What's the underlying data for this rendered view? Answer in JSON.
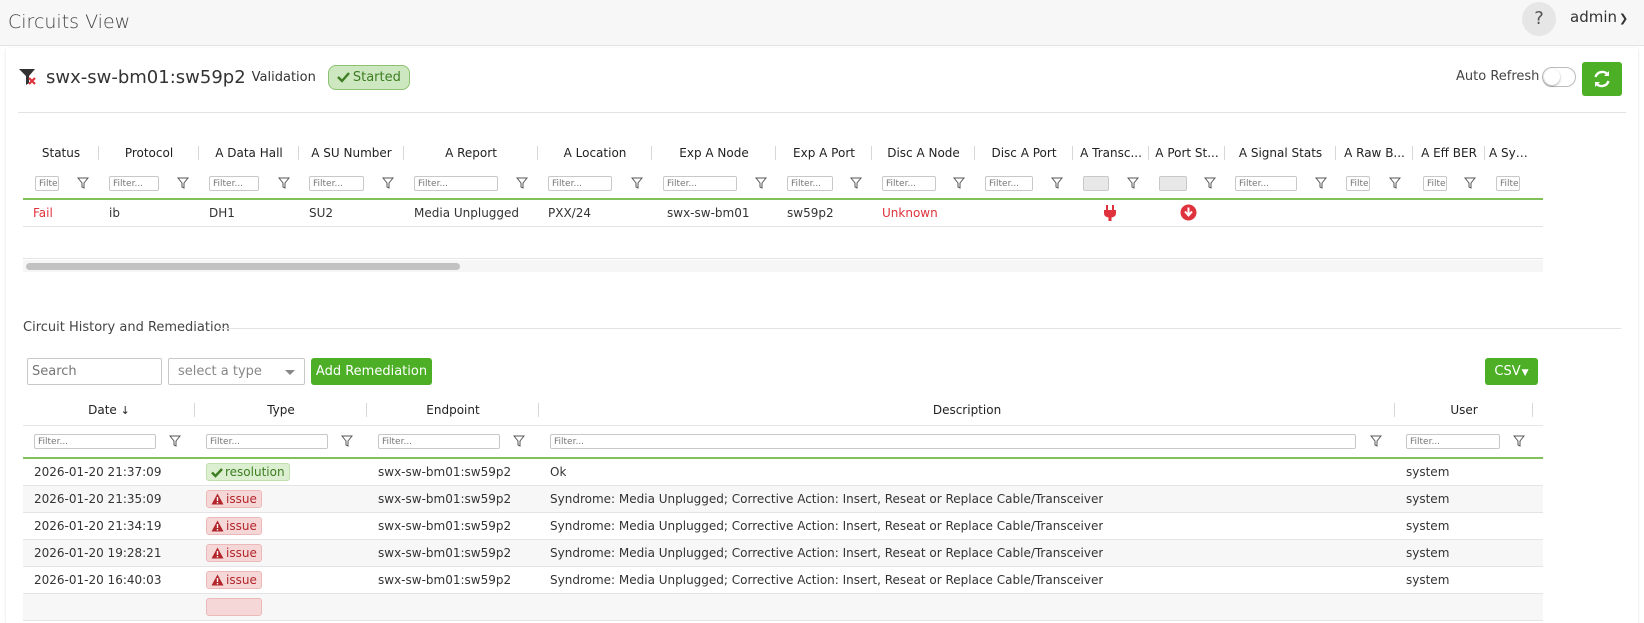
{
  "app": {
    "title": "Circuits View",
    "help": "?",
    "user": "admin"
  },
  "circuit": {
    "name": "swx-sw-bm01:sw59p2",
    "subtitle": "Validation",
    "status_badge": "Started",
    "auto_refresh_label": "Auto Refresh"
  },
  "circuit_grid": {
    "columns": [
      "Status",
      "Protocol",
      "A Data Hall",
      "A SU Number",
      "A Report",
      "A Location",
      "Exp A Node",
      "Exp A Port",
      "Disc A Node",
      "Disc A Port",
      "A Transc...",
      "A Port St...",
      "A Signal Stats",
      "A Raw B...",
      "A Eff BER",
      "A Symb..."
    ],
    "filter_placeholder": "Filter...",
    "row": {
      "status": "Fail",
      "protocol": "ib",
      "data_hall": "DH1",
      "su_number": "SU2",
      "report": "Media Unplugged",
      "location": "PXX/24",
      "exp_node": "swx-sw-bm01",
      "exp_port": "sw59p2",
      "disc_node": "Unknown",
      "transceiver_icon": "plug-icon",
      "port_state_icon": "down-arrow-circle-icon"
    }
  },
  "history": {
    "title": "Circuit History and Remediation",
    "search_placeholder": "Search",
    "type_placeholder": "select a type",
    "add_button": "Add Remediation",
    "csv_button": "CSV",
    "columns": [
      "Date",
      "Type",
      "Endpoint",
      "Description",
      "User"
    ],
    "filter_placeholder": "Filter...",
    "rows": [
      {
        "date": "2026-01-20 21:37:09",
        "type": "resolution",
        "endpoint": "swx-sw-bm01:sw59p2",
        "description": "Ok",
        "user": "system"
      },
      {
        "date": "2026-01-20 21:35:09",
        "type": "issue",
        "endpoint": "swx-sw-bm01:sw59p2",
        "description": "Syndrome: Media Unplugged; Corrective Action: Insert, Reseat or Replace Cable/Transceiver",
        "user": "system"
      },
      {
        "date": "2026-01-20 21:34:19",
        "type": "issue",
        "endpoint": "swx-sw-bm01:sw59p2",
        "description": "Syndrome: Media Unplugged; Corrective Action: Insert, Reseat or Replace Cable/Transceiver",
        "user": "system"
      },
      {
        "date": "2026-01-20 19:28:21",
        "type": "issue",
        "endpoint": "swx-sw-bm01:sw59p2",
        "description": "Syndrome: Media Unplugged; Corrective Action: Insert, Reseat or Replace Cable/Transceiver",
        "user": "system"
      },
      {
        "date": "2026-01-20 16:40:03",
        "type": "issue",
        "endpoint": "swx-sw-bm01:sw59p2",
        "description": "Syndrome: Media Unplugged; Corrective Action: Insert, Reseat or Replace Cable/Transceiver",
        "user": "system"
      }
    ]
  },
  "colors": {
    "accent_green": "#4caf26",
    "fail_red": "#e0323c"
  }
}
